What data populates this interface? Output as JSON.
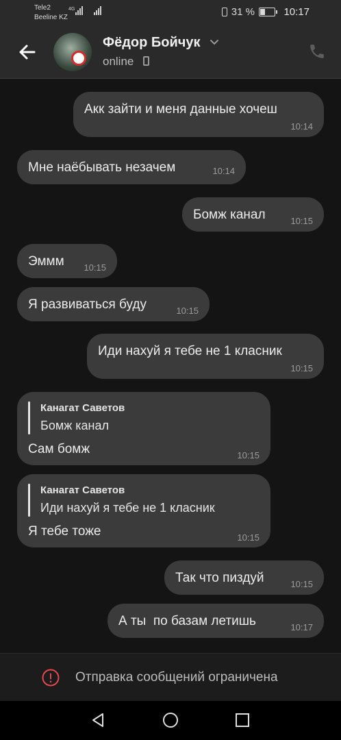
{
  "status_bar": {
    "carrier_1": "Tele2",
    "carrier_2": "Beeline KZ",
    "network_type": "4G",
    "battery": "31 %",
    "time": "10:17"
  },
  "header": {
    "contact_name": "Фёдор Бойчук",
    "presence": "online"
  },
  "messages": [
    {
      "side": "out",
      "text": "Акк зайти и меня данные хочеш",
      "time": "10:14"
    },
    {
      "side": "in",
      "text": "Мне наёбывать незачем",
      "time": "10:14"
    },
    {
      "side": "out",
      "text": "Бомж канал",
      "time": "10:15"
    },
    {
      "side": "in",
      "text": "Эммм",
      "time": "10:15"
    },
    {
      "side": "in",
      "text": "Я развиваться буду",
      "time": "10:15"
    },
    {
      "side": "out",
      "text": "Иди нахуй я тебе не 1 класник",
      "time": "10:15"
    },
    {
      "side": "in",
      "reply_author": "Канагат Саветов",
      "reply_text": "Бомж канал",
      "text": "Сам бомж",
      "time": "10:15"
    },
    {
      "side": "in",
      "reply_author": "Канагат Саветов",
      "reply_text": "Иди нахуй я тебе не 1 класник",
      "text": "Я тебе тоже",
      "time": "10:15"
    },
    {
      "side": "out",
      "text": "Так что пиздуй",
      "time": "10:15"
    },
    {
      "side": "out",
      "text": "А ты  по базам летишь",
      "time": "10:17"
    }
  ],
  "footer": {
    "restriction_text": "Отправка сообщений ограничена"
  },
  "icons": {
    "back": "arrow-left-icon",
    "call": "phone-icon",
    "alert": "exclamation-circle-icon",
    "nav_back": "triangle-back-icon",
    "nav_home": "circle-home-icon",
    "nav_recent": "square-recent-icon"
  }
}
